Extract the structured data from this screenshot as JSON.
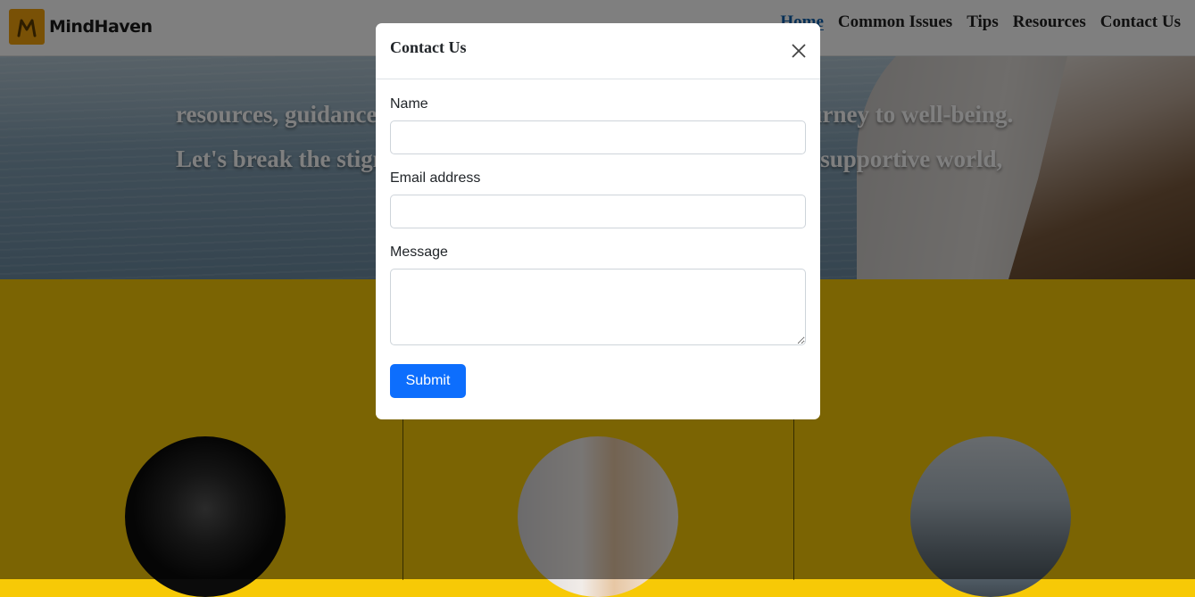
{
  "navbar": {
    "brand_name": "MindHaven",
    "logo_icon": "mindhaven-logo-icon",
    "links": [
      {
        "label": "Home",
        "active": true
      },
      {
        "label": "Common Issues",
        "active": false
      },
      {
        "label": "Tips",
        "active": false
      },
      {
        "label": "Resources",
        "active": false
      },
      {
        "label": "Contact Us",
        "active": false
      }
    ]
  },
  "hero": {
    "line1_left": "resources, guidance,",
    "line1_right": "journey to well-being.",
    "line2_left": "Let's break the stigm",
    "line2_right": "re supportive world,"
  },
  "modal": {
    "title": "Contact Us",
    "close_icon": "close-icon",
    "name_label": "Name",
    "name_value": "",
    "email_label": "Email address",
    "email_value": "",
    "message_label": "Message",
    "message_value": "",
    "submit_label": "Submit"
  },
  "colors": {
    "brand_accent": "#f2a20c",
    "section_bg": "#f7c906",
    "primary_button": "#0d6efd",
    "active_nav": "#0b5fad"
  }
}
